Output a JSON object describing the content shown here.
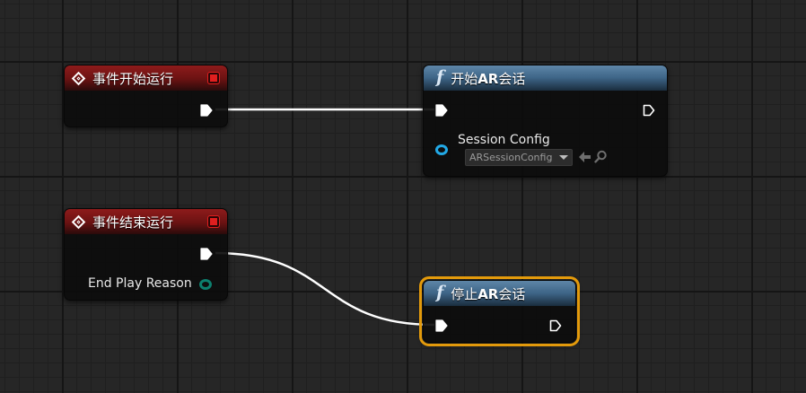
{
  "nodes": {
    "begin_play": {
      "title": "事件开始运行"
    },
    "start_ar": {
      "title_prefix": "开始",
      "title_bold": "AR",
      "title_suffix": "会话",
      "pin_session_config": "Session Config",
      "session_config_value": "ARSessionConfig"
    },
    "end_play": {
      "title": "事件结束运行",
      "pin_end_play_reason": "End Play Reason"
    },
    "stop_ar": {
      "title_prefix": "停止",
      "title_bold": "AR",
      "title_suffix": "会话"
    }
  },
  "colors": {
    "event_header": "#8e1b1b",
    "function_header": "#3d6486",
    "selection": "#e39a0b",
    "object_pin": "#22a9e6",
    "enum_pin": "#0d7f6e",
    "exec_pin": "#ffffff"
  }
}
